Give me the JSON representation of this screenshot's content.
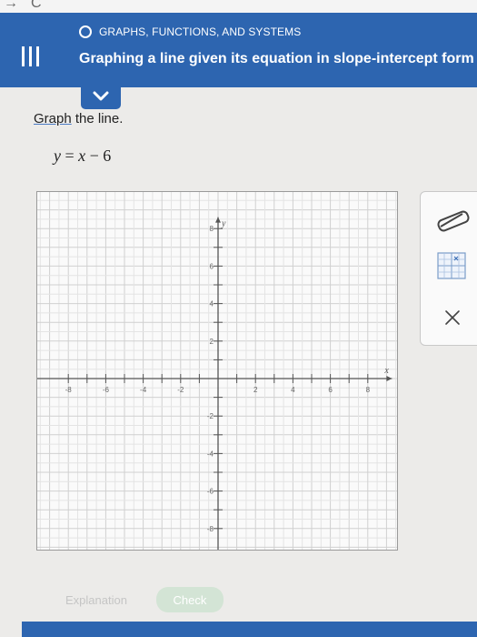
{
  "browser": {
    "back_glyph": "→",
    "reload_glyph": "C"
  },
  "header": {
    "topic": "GRAPHS, FUNCTIONS, AND SYSTEMS",
    "title": "Graphing a line given its equation in slope-intercept form",
    "menu_icon": "menu-icon",
    "collapse_icon": "chevron-down-icon"
  },
  "question": {
    "instruction_link": "Graph",
    "instruction_rest": " the line.",
    "equation_y": "y",
    "equation_eq": " = ",
    "equation_x": "x",
    "equation_rest": " − 6"
  },
  "graph": {
    "x_axis_label": "x",
    "y_axis_label": "y",
    "x_range": [
      -9,
      9
    ],
    "y_range": [
      -9,
      9
    ],
    "x_tick_labels": [
      "-8",
      "-6",
      "-4",
      "-2",
      "2",
      "4",
      "6",
      "8"
    ],
    "y_tick_labels": [
      "8",
      "6",
      "4",
      "2",
      "-2",
      "-4",
      "-6",
      "-8"
    ]
  },
  "tools": [
    "line-tool-icon",
    "table-tool-icon",
    "clear-icon"
  ],
  "actions": {
    "explanation_label": "Explanation",
    "check_label": "Check"
  },
  "colors": {
    "header_blue": "#2d65b0",
    "check_green": "#d3e4d5"
  }
}
